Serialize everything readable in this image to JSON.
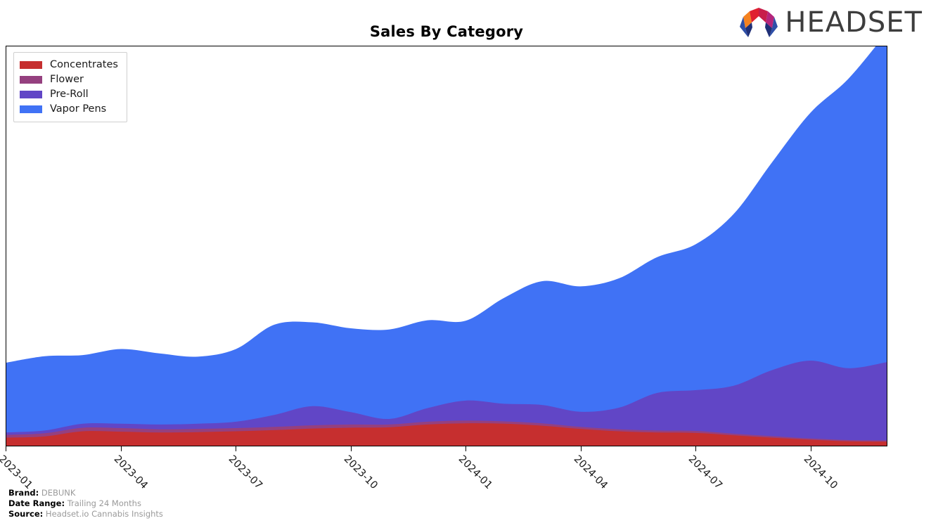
{
  "header": {
    "title": "Sales By Category",
    "logo_text": "HEADSET",
    "logo_colors": {
      "orange": "#f58220",
      "red": "#e02030",
      "crimson": "#c81e4a",
      "magenta": "#b5257c",
      "blue": "#2e4fa8",
      "navy": "#1f2f77",
      "wordmark": "#3d3d3d"
    }
  },
  "legend": {
    "position": "top-left-inside",
    "items": [
      {
        "label": "Concentrates",
        "color": "#c62f2f"
      },
      {
        "label": "Flower",
        "color": "#95407f"
      },
      {
        "label": "Pre-Roll",
        "color": "#6146c6"
      },
      {
        "label": "Vapor Pens",
        "color": "#4072f5"
      }
    ]
  },
  "footer": {
    "rows": [
      {
        "key": "Brand:",
        "value": "DEBUNK"
      },
      {
        "key": "Date Range:",
        "value": "Trailing 24 Months"
      },
      {
        "key": "Source:",
        "value": "Headset.io Cannabis Insights"
      }
    ]
  },
  "chart_data": {
    "type": "area",
    "stacked": true,
    "title": "Sales By Category",
    "xlabel": "",
    "ylabel": "",
    "grid": false,
    "legend_position": "top-left-inside",
    "axis_tick_rotation": 45,
    "ylim": [
      0,
      100
    ],
    "x": [
      "2023-01",
      "2023-02",
      "2023-03",
      "2023-04",
      "2023-05",
      "2023-06",
      "2023-07",
      "2023-08",
      "2023-09",
      "2023-10",
      "2023-11",
      "2023-12",
      "2024-01",
      "2024-02",
      "2024-03",
      "2024-04",
      "2024-05",
      "2024-06",
      "2024-07",
      "2024-08",
      "2024-09",
      "2024-10",
      "2024-11",
      "2024-12"
    ],
    "tick_labels": [
      "2023-01",
      "2023-04",
      "2023-07",
      "2023-10",
      "2024-01",
      "2024-04",
      "2024-07",
      "2024-10"
    ],
    "tick_indices": [
      0,
      3,
      6,
      9,
      12,
      15,
      18,
      21
    ],
    "series": [
      {
        "name": "Concentrates",
        "color": "#c62f2f",
        "values": [
          2.0,
          2.3,
          3.6,
          3.5,
          3.3,
          3.4,
          3.6,
          3.9,
          4.3,
          4.5,
          4.6,
          5.3,
          5.6,
          5.5,
          5.0,
          4.2,
          3.6,
          3.3,
          3.2,
          2.6,
          2.0,
          1.5,
          1.1,
          1.0
        ]
      },
      {
        "name": "Flower",
        "color": "#95407f",
        "values": [
          0.7,
          0.8,
          0.9,
          0.9,
          0.8,
          0.8,
          0.8,
          0.8,
          0.8,
          0.8,
          0.7,
          0.7,
          0.7,
          0.6,
          0.6,
          0.5,
          0.5,
          0.5,
          0.5,
          0.4,
          0.4,
          0.3,
          0.3,
          0.3
        ]
      },
      {
        "name": "Pre-Roll",
        "color": "#6146c6",
        "values": [
          0.6,
          0.7,
          1.0,
          1.1,
          1.2,
          1.3,
          1.6,
          3.0,
          4.8,
          3.1,
          1.4,
          3.4,
          5.0,
          4.4,
          4.6,
          3.8,
          5.4,
          9.4,
          10.2,
          12.0,
          16.5,
          19.5,
          18.0,
          19.6
        ]
      },
      {
        "name": "Vapor Pens",
        "color": "#4072f5",
        "values": [
          17.5,
          18.6,
          17.2,
          18.7,
          17.8,
          16.8,
          18.2,
          22.6,
          21.0,
          21.0,
          22.4,
          22.0,
          20.0,
          26.5,
          31.0,
          31.4,
          32.4,
          34.0,
          36.5,
          43.0,
          52.0,
          62.0,
          72.5,
          82.6
        ]
      }
    ]
  }
}
